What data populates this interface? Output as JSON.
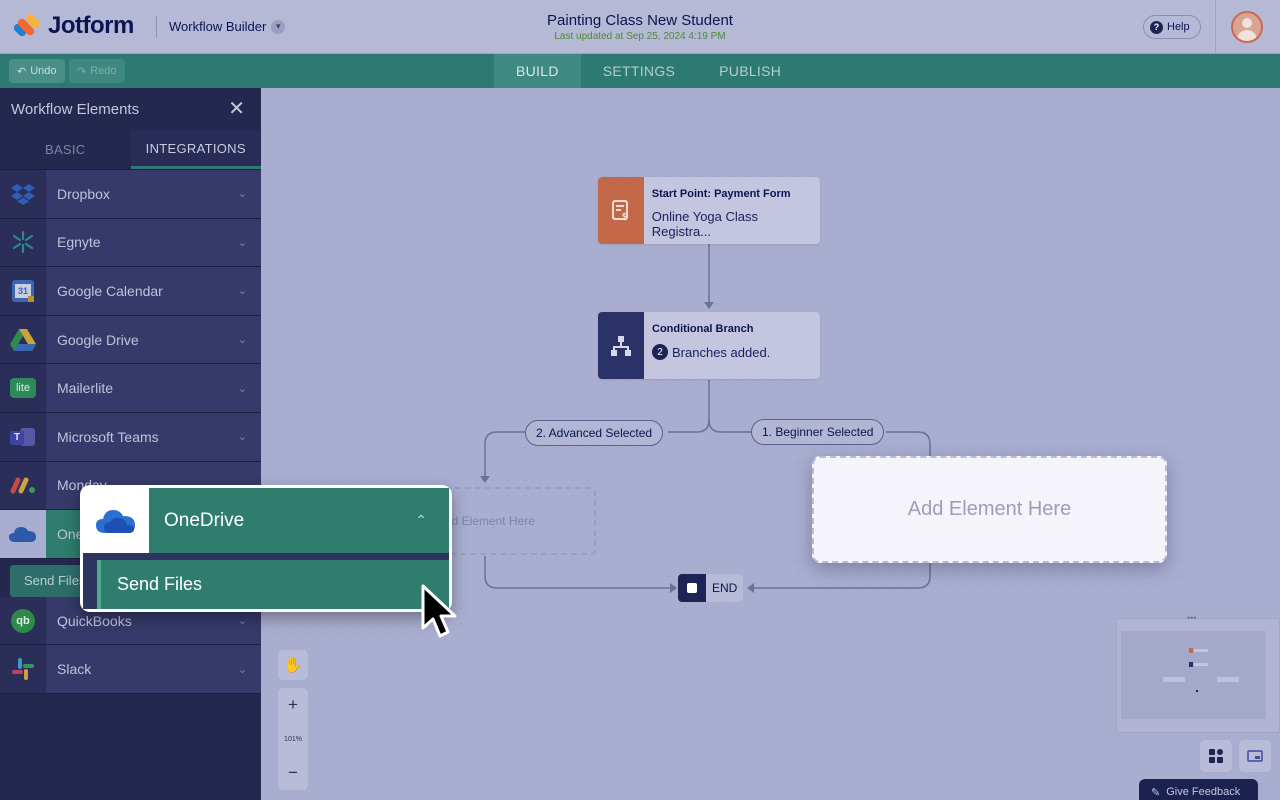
{
  "header": {
    "logo_text": "Jotform",
    "workflow_builder": "Workflow Builder",
    "form_title": "Painting Class New Student",
    "last_updated": "Last updated at Sep 25, 2024 4:19 PM",
    "help": "Help"
  },
  "toolbar": {
    "undo": "Undo",
    "redo": "Redo",
    "tabs": [
      "BUILD",
      "SETTINGS",
      "PUBLISH"
    ],
    "active_tab": "BUILD"
  },
  "sidebar": {
    "title": "Workflow Elements",
    "tabs": [
      "BASIC",
      "INTEGRATIONS"
    ],
    "active_tab": "INTEGRATIONS",
    "items": [
      {
        "label": "Dropbox",
        "icon": "dropbox-icon"
      },
      {
        "label": "Egnyte",
        "icon": "egnyte-icon"
      },
      {
        "label": "Google Calendar",
        "icon": "google-calendar-icon"
      },
      {
        "label": "Google Drive",
        "icon": "google-drive-icon"
      },
      {
        "label": "Mailerlite",
        "icon": "mailerlite-icon"
      },
      {
        "label": "Microsoft Teams",
        "icon": "microsoft-teams-icon"
      },
      {
        "label": "Monday",
        "icon": "monday-icon"
      },
      {
        "label": "OneDrive",
        "icon": "onedrive-icon"
      },
      {
        "label": "QuickBooks",
        "icon": "quickbooks-icon"
      },
      {
        "label": "Slack",
        "icon": "slack-icon"
      }
    ],
    "send_files": "Send Files",
    "calendar_day": "31",
    "mailerlite_glyph": "lite"
  },
  "canvas": {
    "start_node": {
      "title": "Start Point: Payment Form",
      "subtitle": "Online Yoga Class Registra..."
    },
    "branch_node": {
      "title": "Conditional Branch",
      "count": "2",
      "subtitle": "Branches added."
    },
    "pill_advanced": "2. Advanced Selected",
    "pill_beginner": "1. Beginner Selected",
    "add_element_small": "Add Element Here",
    "add_element_large": "Add Element Here",
    "end": "END",
    "zoom_level": "101%",
    "zoom_in": "+",
    "zoom_out": "−",
    "give_feedback": "Give Feedback"
  },
  "callout": {
    "title": "OneDrive",
    "action": "Send Files"
  },
  "colors": {
    "accent": "#2f7d6d",
    "navy": "#0a1551",
    "start_icon_bg": "#c3694a",
    "branch_icon_bg": "#2a3268"
  }
}
